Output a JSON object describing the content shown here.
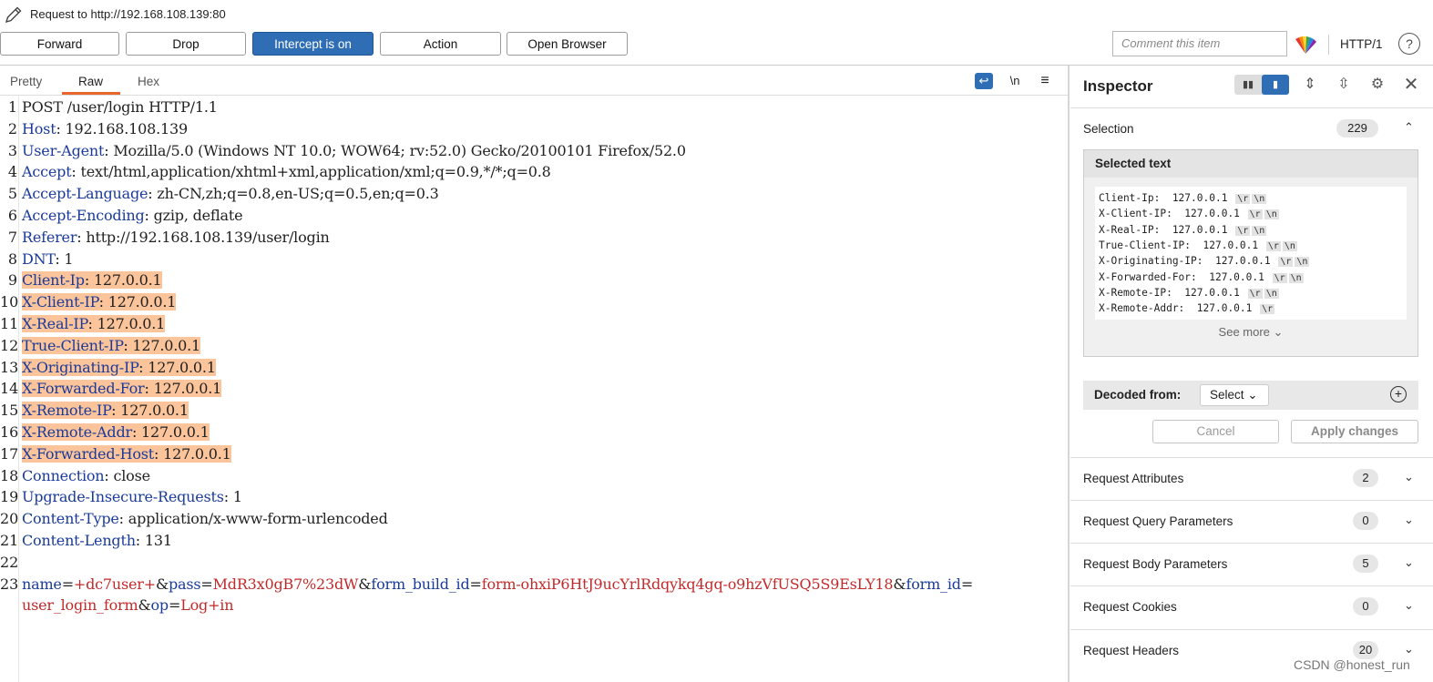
{
  "window": {
    "title": "Request to http://192.168.108.139:80"
  },
  "toolbar": {
    "forward": "Forward",
    "drop": "Drop",
    "intercept": "Intercept is on",
    "action": "Action",
    "open_browser": "Open Browser",
    "comment_placeholder": "Comment this item",
    "protocol": "HTTP/1",
    "help": "?"
  },
  "editor": {
    "tabs": [
      "Pretty",
      "Raw",
      "Hex"
    ],
    "active_tab": "Raw",
    "icon_newline": "\\n",
    "lines": [
      {
        "n": "1",
        "plain": "POST /user/login HTTP/1.1"
      },
      {
        "n": "2",
        "key": "Host",
        "val": " 192.168.108.139"
      },
      {
        "n": "3",
        "key": "User-Agent",
        "val": " Mozilla/5.0 (Windows NT 10.0; WOW64; rv:52.0) Gecko/20100101 Firefox/52.0"
      },
      {
        "n": "4",
        "key": "Accept",
        "val": " text/html,application/xhtml+xml,application/xml;q=0.9,*/*;q=0.8"
      },
      {
        "n": "5",
        "key": "Accept-Language",
        "val": " zh-CN,zh;q=0.8,en-US;q=0.5,en;q=0.3"
      },
      {
        "n": "6",
        "key": "Accept-Encoding",
        "val": " gzip, deflate"
      },
      {
        "n": "7",
        "key": "Referer",
        "val": " http://192.168.108.139/user/login"
      },
      {
        "n": "8",
        "key": "DNT",
        "val": " 1"
      },
      {
        "n": "9",
        "key": "Client-Ip",
        "val": " 127.0.0.1",
        "hl": true
      },
      {
        "n": "10",
        "key": "X-Client-IP",
        "val": " 127.0.0.1",
        "hl": true
      },
      {
        "n": "11",
        "key": "X-Real-IP",
        "val": " 127.0.0.1",
        "hl": true
      },
      {
        "n": "12",
        "key": "True-Client-IP",
        "val": " 127.0.0.1",
        "hl": true
      },
      {
        "n": "13",
        "key": "X-Originating-IP",
        "val": " 127.0.0.1",
        "hl": true
      },
      {
        "n": "14",
        "key": "X-Forwarded-For",
        "val": " 127.0.0.1",
        "hl": true
      },
      {
        "n": "15",
        "key": "X-Remote-IP",
        "val": " 127.0.0.1",
        "hl": true
      },
      {
        "n": "16",
        "key": "X-Remote-Addr",
        "val": " 127.0.0.1",
        "hl": true
      },
      {
        "n": "17",
        "key": "X-Forwarded-Host",
        "val": " 127.0.0.1",
        "hl": true
      },
      {
        "n": "18",
        "key": "Connection",
        "val": " close"
      },
      {
        "n": "19",
        "key": "Upgrade-Insecure-Requests",
        "val": " 1"
      },
      {
        "n": "20",
        "key": "Content-Type",
        "val": " application/x-www-form-urlencoded"
      },
      {
        "n": "21",
        "key": "Content-Length",
        "val": " 131"
      },
      {
        "n": "22",
        "plain": ""
      },
      {
        "n": "23",
        "body": [
          [
            "pn",
            "name"
          ],
          [
            "eq",
            "="
          ],
          [
            "pv",
            "+dc7user+"
          ],
          [
            "eq",
            "&"
          ],
          [
            "pn",
            "pass"
          ],
          [
            "eq",
            "="
          ],
          [
            "pv",
            "MdR3x0gB7%23dW"
          ],
          [
            "eq",
            "&"
          ],
          [
            "pn",
            "form_build_id"
          ],
          [
            "eq",
            "="
          ],
          [
            "pv",
            "form-ohxiP6HtJ9ucYrlRdqykq4gq-o9hzVfUSQ5S9EsLY18"
          ],
          [
            "eq",
            "&"
          ],
          [
            "pn",
            "form_id"
          ],
          [
            "eq",
            "="
          ]
        ]
      },
      {
        "n": "",
        "body": [
          [
            "pv",
            "user_login_form"
          ],
          [
            "eq",
            "&"
          ],
          [
            "pn",
            "op"
          ],
          [
            "eq",
            "="
          ],
          [
            "pv",
            "Log+in"
          ]
        ]
      }
    ]
  },
  "inspector": {
    "title": "Inspector",
    "selection_label": "Selection",
    "selection_count": "229",
    "selected_text_title": "Selected text",
    "selected_lines": [
      {
        "k": "Client-Ip:",
        "v": "127.0.0.1",
        "e": [
          "\\r",
          "\\n"
        ]
      },
      {
        "k": "X-Client-IP:",
        "v": "127.0.0.1",
        "e": [
          "\\r",
          "\\n"
        ]
      },
      {
        "k": "X-Real-IP:",
        "v": "127.0.0.1",
        "e": [
          "\\r",
          "\\n"
        ]
      },
      {
        "k": "True-Client-IP:",
        "v": "127.0.0.1",
        "e": [
          "\\r",
          "\\n"
        ]
      },
      {
        "k": "X-Originating-IP:",
        "v": "127.0.0.1",
        "e": [
          "\\r",
          "\\n"
        ]
      },
      {
        "k": "X-Forwarded-For:",
        "v": "127.0.0.1",
        "e": [
          "\\r",
          "\\n"
        ]
      },
      {
        "k": "X-Remote-IP:",
        "v": "127.0.0.1",
        "e": [
          "\\r",
          "\\n"
        ]
      },
      {
        "k": "X-Remote-Addr:",
        "v": "127.0.0.1",
        "e": [
          "\\r"
        ]
      }
    ],
    "see_more": "See more",
    "decoded_from": "Decoded from:",
    "decoded_select": "Select",
    "cancel": "Cancel",
    "apply": "Apply changes",
    "sections": [
      {
        "label": "Request Attributes",
        "count": "2"
      },
      {
        "label": "Request Query Parameters",
        "count": "0"
      },
      {
        "label": "Request Body Parameters",
        "count": "5"
      },
      {
        "label": "Request Cookies",
        "count": "0"
      },
      {
        "label": "Request Headers",
        "count": "20"
      }
    ]
  },
  "watermark": "CSDN @honest_run"
}
